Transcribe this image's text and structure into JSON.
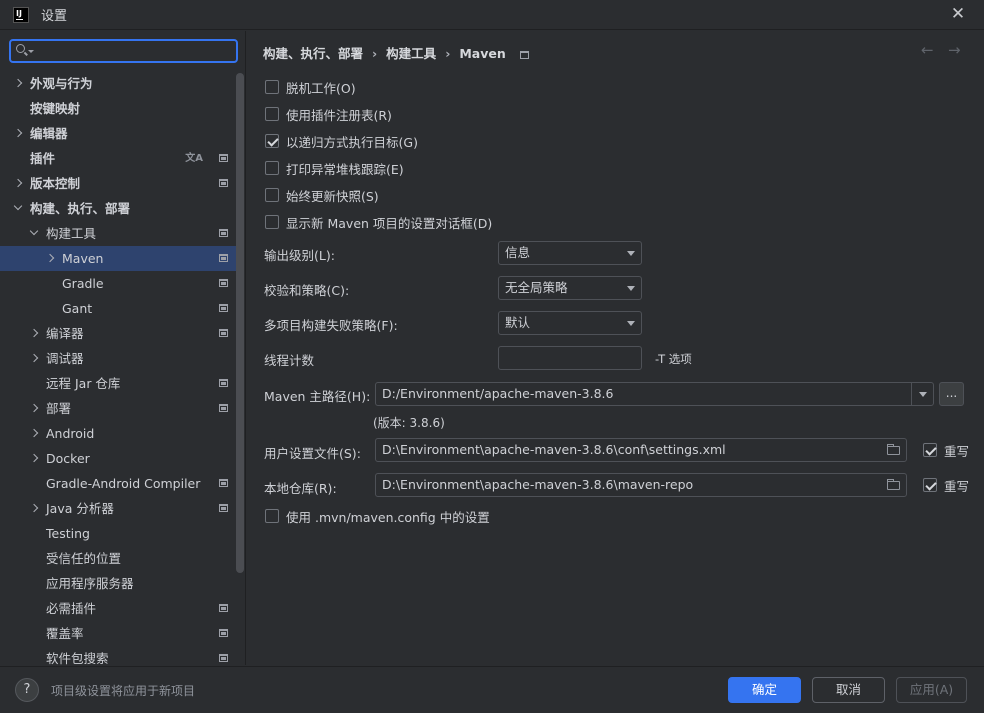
{
  "window": {
    "title": "设置",
    "app_icon_text": "IJ"
  },
  "search": {
    "value": "",
    "placeholder": ""
  },
  "sidebar": {
    "items": [
      {
        "label": "外观与行为",
        "level": 0,
        "chevron": "right",
        "bold": true
      },
      {
        "label": "按键映射",
        "level": 0,
        "chevron": "none",
        "bold": true
      },
      {
        "label": "编辑器",
        "level": 0,
        "chevron": "right",
        "bold": true
      },
      {
        "label": "插件",
        "level": 0,
        "chevron": "none",
        "bold": true,
        "icons": [
          "translate-icon",
          "scope-icon"
        ]
      },
      {
        "label": "版本控制",
        "level": 0,
        "chevron": "right",
        "bold": true,
        "icons": [
          "scope-icon"
        ]
      },
      {
        "label": "构建、执行、部署",
        "level": 0,
        "chevron": "down",
        "bold": true
      },
      {
        "label": "构建工具",
        "level": 1,
        "chevron": "down",
        "icons": [
          "scope-icon"
        ]
      },
      {
        "label": "Maven",
        "level": 2,
        "chevron": "right",
        "selected": true,
        "icons": [
          "scope-icon"
        ]
      },
      {
        "label": "Gradle",
        "level": 2,
        "chevron": "none",
        "icons": [
          "scope-icon"
        ]
      },
      {
        "label": "Gant",
        "level": 2,
        "chevron": "none",
        "icons": [
          "scope-icon"
        ]
      },
      {
        "label": "编译器",
        "level": 1,
        "chevron": "right",
        "icons": [
          "scope-icon"
        ]
      },
      {
        "label": "调试器",
        "level": 1,
        "chevron": "right"
      },
      {
        "label": "远程 Jar 仓库",
        "level": 1,
        "chevron": "none",
        "icons": [
          "scope-icon"
        ]
      },
      {
        "label": "部署",
        "level": 1,
        "chevron": "right",
        "icons": [
          "scope-icon"
        ]
      },
      {
        "label": "Android",
        "level": 1,
        "chevron": "right"
      },
      {
        "label": "Docker",
        "level": 1,
        "chevron": "right"
      },
      {
        "label": "Gradle-Android Compiler",
        "level": 1,
        "chevron": "none",
        "icons": [
          "scope-icon"
        ]
      },
      {
        "label": "Java 分析器",
        "level": 1,
        "chevron": "right",
        "icons": [
          "scope-icon"
        ]
      },
      {
        "label": "Testing",
        "level": 1,
        "chevron": "none"
      },
      {
        "label": "受信任的位置",
        "level": 1,
        "chevron": "none"
      },
      {
        "label": "应用程序服务器",
        "level": 1,
        "chevron": "none"
      },
      {
        "label": "必需插件",
        "level": 1,
        "chevron": "none",
        "icons": [
          "scope-icon"
        ]
      },
      {
        "label": "覆盖率",
        "level": 1,
        "chevron": "none",
        "icons": [
          "scope-icon"
        ]
      },
      {
        "label": "软件包搜索",
        "level": 1,
        "chevron": "none",
        "icons": [
          "scope-icon"
        ]
      }
    ]
  },
  "breadcrumb": {
    "items": [
      "构建、执行、部署",
      "构建工具",
      "Maven"
    ],
    "separator": "›"
  },
  "nav": {
    "back": "←",
    "forward": "→"
  },
  "options": {
    "offline": {
      "label": "脱机工作(O)",
      "checked": false
    },
    "plugin_registry": {
      "label": "使用插件注册表(R)",
      "checked": false
    },
    "recursive": {
      "label": "以递归方式执行目标(G)",
      "checked": true
    },
    "stack_trace": {
      "label": "打印异常堆栈跟踪(E)",
      "checked": false
    },
    "update_snapshots": {
      "label": "始终更新快照(S)",
      "checked": false
    },
    "show_dialog": {
      "label": "显示新 Maven 项目的设置对话框(D)",
      "checked": false
    },
    "mvn_config": {
      "label": "使用 .mvn/maven.config 中的设置",
      "checked": false
    }
  },
  "fields": {
    "output_level": {
      "label": "输出级别(L):",
      "value": "信息"
    },
    "checksum_policy": {
      "label": "校验和策略(C):",
      "value": "无全局策略"
    },
    "failure_policy": {
      "label": "多项目构建失败策略(F):",
      "value": "默认"
    },
    "thread_count": {
      "label": "线程计数",
      "value": "",
      "suffix": "-T 选项"
    },
    "maven_home": {
      "label": "Maven 主路径(H):",
      "value": "D:/Environment/apache-maven-3.8.6",
      "version": "(版本: 3.8.6)",
      "browse": "..."
    },
    "user_settings": {
      "label": "用户设置文件(S):",
      "value": "D:\\Environment\\apache-maven-3.8.6\\conf\\settings.xml",
      "override_label": "重写",
      "override": true
    },
    "local_repo": {
      "label": "本地仓库(R):",
      "value": "D:\\Environment\\apache-maven-3.8.6\\maven-repo",
      "override_label": "重写",
      "override": true
    }
  },
  "footer": {
    "help": "?",
    "hint": "项目级设置将应用于新项目",
    "ok": "确定",
    "cancel": "取消",
    "apply": "应用(A)"
  },
  "colors": {
    "background": "#2b2d30",
    "selection": "#2e436e",
    "accent": "#3574f0"
  }
}
